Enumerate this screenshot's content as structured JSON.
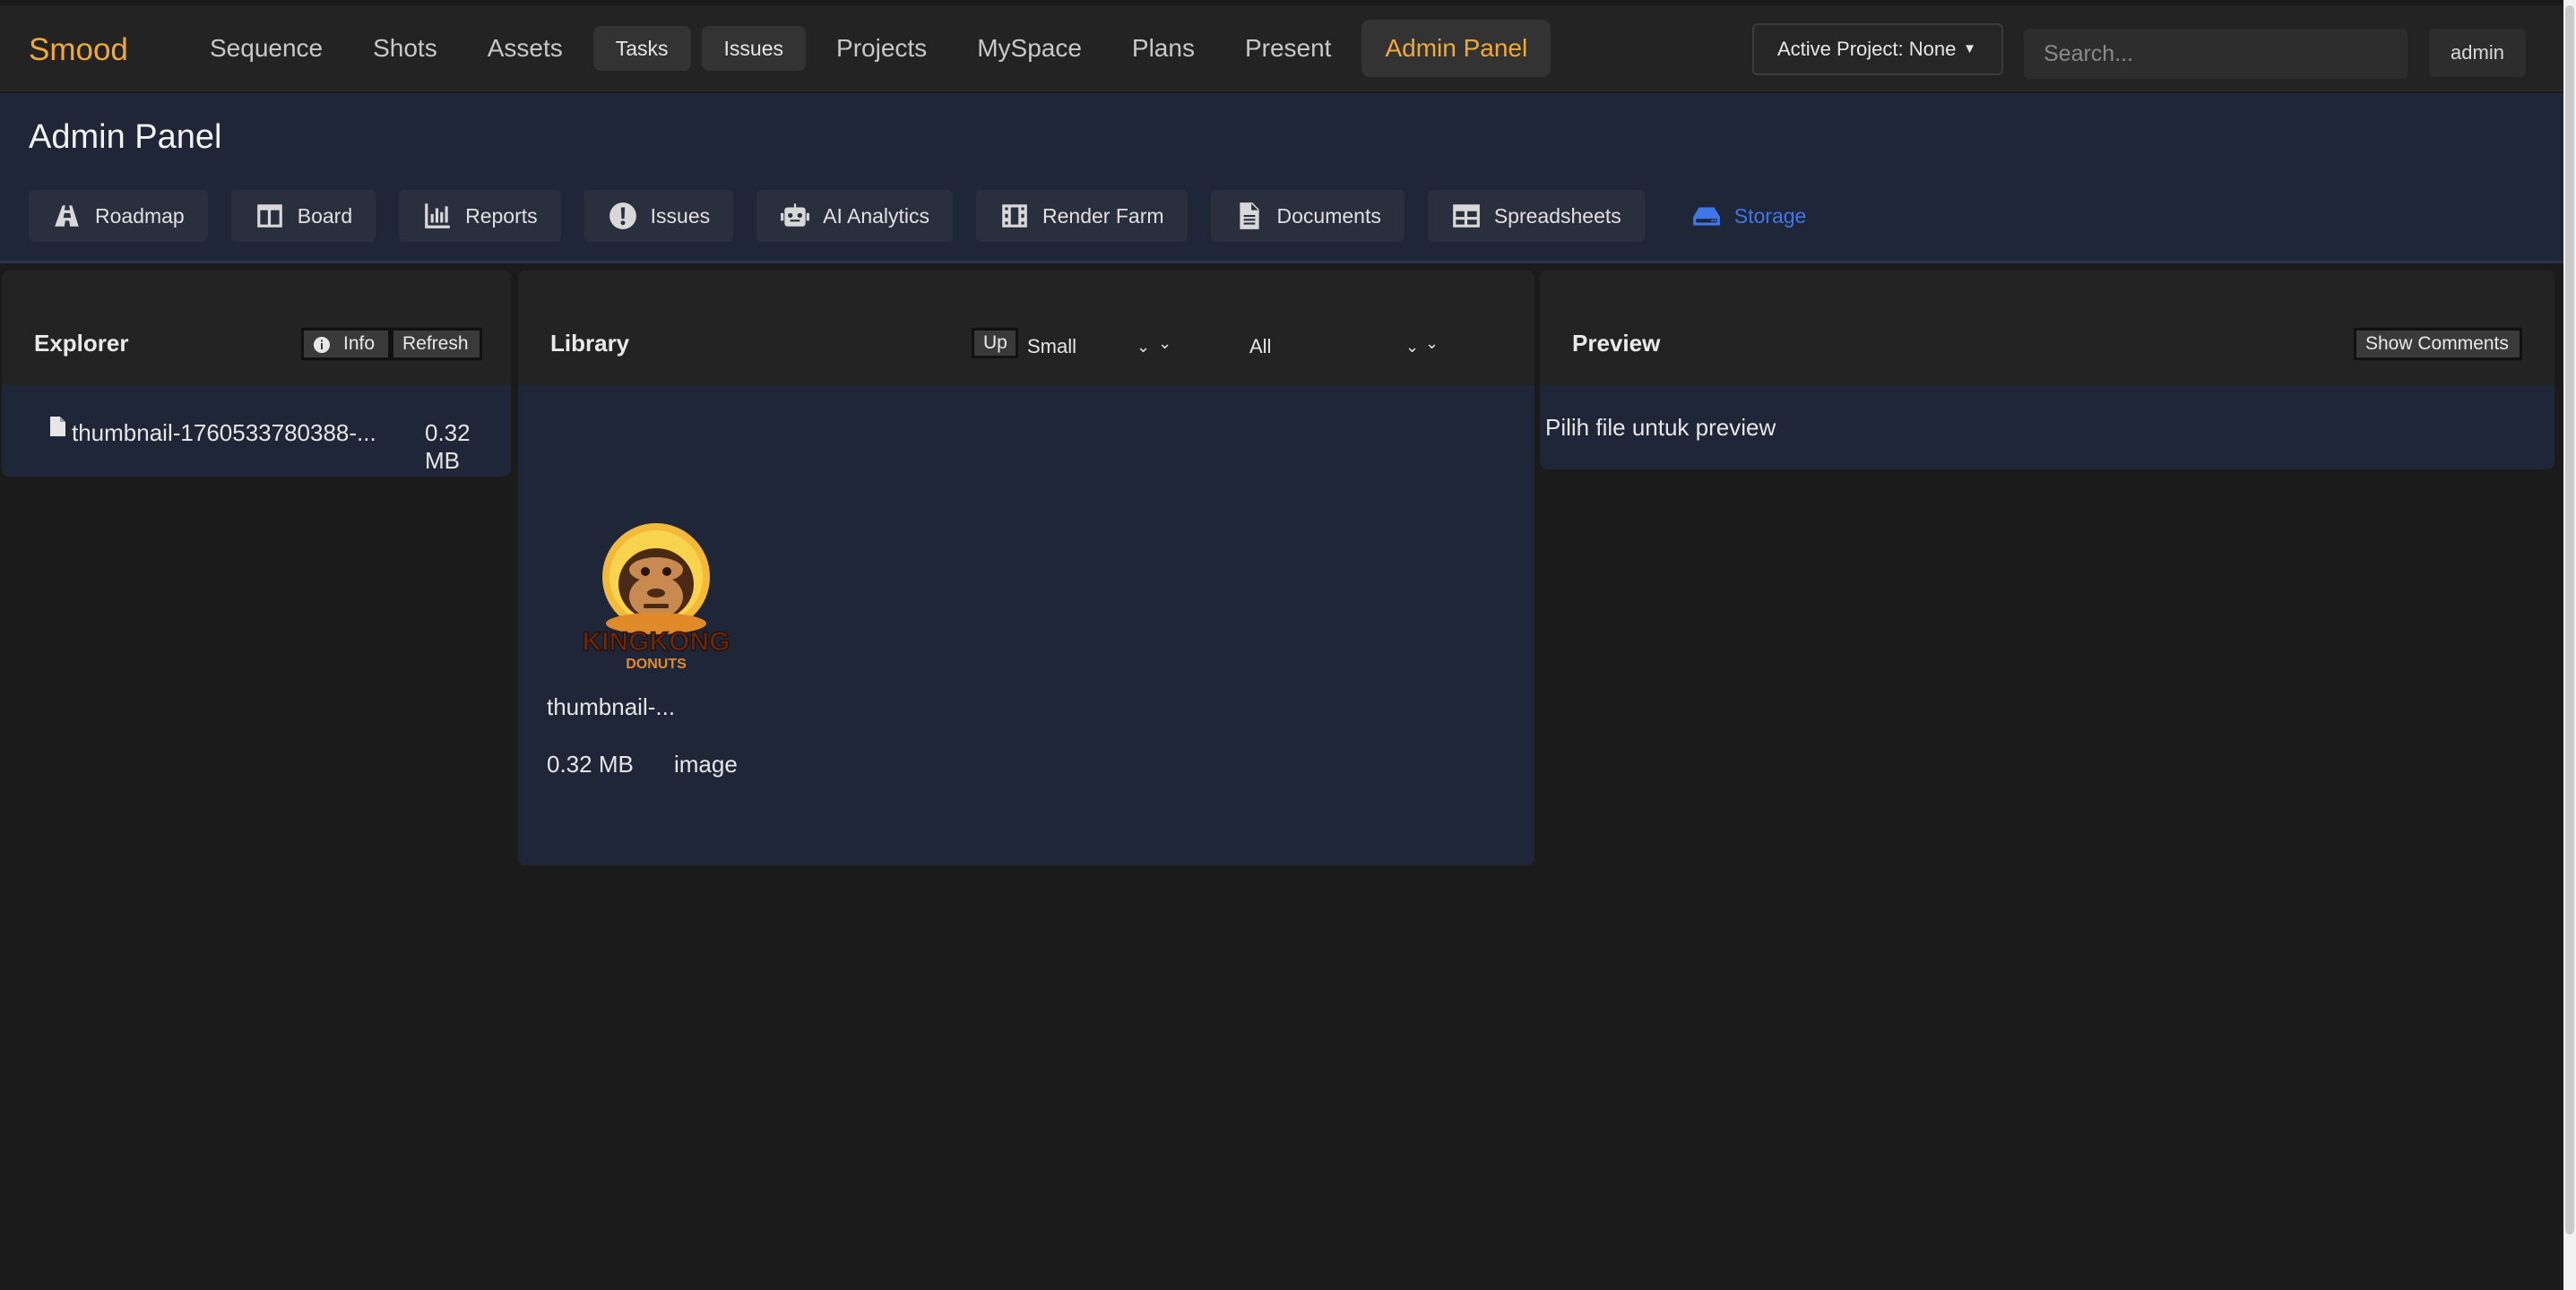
{
  "app": {
    "logo": "Smood"
  },
  "nav": {
    "items": [
      "Sequence",
      "Shots",
      "Assets"
    ],
    "buttons": [
      "Tasks",
      "Issues"
    ],
    "items2": [
      "Projects",
      "MySpace",
      "Plans",
      "Present"
    ],
    "active": "Admin Panel"
  },
  "project_select": {
    "label": "Active Project: None",
    "caret": "▼"
  },
  "search": {
    "placeholder": "Search..."
  },
  "user": {
    "label": "admin"
  },
  "admin": {
    "title": "Admin Panel",
    "tabs": [
      {
        "label": "Roadmap",
        "icon": "road-icon"
      },
      {
        "label": "Board",
        "icon": "board-icon"
      },
      {
        "label": "Reports",
        "icon": "bar-chart-icon"
      },
      {
        "label": "Issues",
        "icon": "exclamation-circle-icon"
      },
      {
        "label": "AI Analytics",
        "icon": "robot-icon"
      },
      {
        "label": "Render Farm",
        "icon": "film-icon"
      },
      {
        "label": "Documents",
        "icon": "document-icon"
      },
      {
        "label": "Spreadsheets",
        "icon": "table-icon"
      },
      {
        "label": "Storage",
        "icon": "hdd-icon"
      }
    ],
    "active_tab": "Storage"
  },
  "explorer": {
    "title": "Explorer",
    "info_label": "Info",
    "refresh_label": "Refresh",
    "files": [
      {
        "name": "thumbnail-1760533780388-...",
        "size": "0.32 MB"
      }
    ]
  },
  "library": {
    "title": "Library",
    "up_label": "Up",
    "size_select": "Small",
    "filter_select": "All",
    "items": [
      {
        "name": "thumbnail-...",
        "size": "0.32 MB",
        "type": "image",
        "logo_top": "KINGKONG",
        "logo_bottom": "DONUTS"
      }
    ]
  },
  "preview": {
    "title": "Preview",
    "comments_label": "Show Comments",
    "empty_message": "Pilih file untuk preview"
  },
  "colors": {
    "accent": "#f0a93a",
    "active_tab": "#3f78e6",
    "panel_bg": "#1f2638",
    "app_bg": "#1b1b1b"
  }
}
